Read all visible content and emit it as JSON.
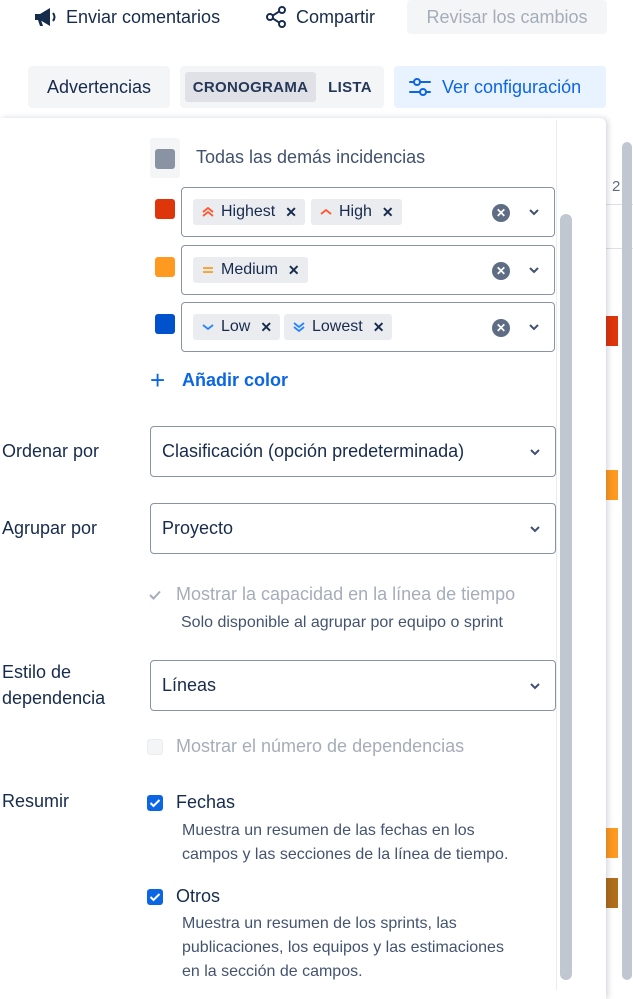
{
  "toolbar": {
    "feedback_label": "Enviar comentarios",
    "share_label": "Compartir",
    "review_label": "Revisar los cambios"
  },
  "view_bar": {
    "warnings_label": "Advertencias",
    "view_modes": [
      "CRONOGRAMA",
      "LISTA"
    ],
    "active_view": "CRONOGRAMA",
    "config_label": "Ver configuración"
  },
  "colors": {
    "accent": "#0c66e4",
    "highest": "#de350b",
    "medium": "#ff991f",
    "low": "#0052cc",
    "all_other": "#8993a4"
  },
  "color_rules": {
    "all_other_label": "Todas las demás incidencias",
    "groups": [
      {
        "color": "#de350b",
        "tags": [
          {
            "label": "Highest",
            "icon": "priority-highest-icon"
          },
          {
            "label": "High",
            "icon": "priority-high-icon"
          }
        ]
      },
      {
        "color": "#ff991f",
        "tags": [
          {
            "label": "Medium",
            "icon": "priority-medium-icon"
          }
        ]
      },
      {
        "color": "#0052cc",
        "tags": [
          {
            "label": "Low",
            "icon": "priority-low-icon"
          },
          {
            "label": "Lowest",
            "icon": "priority-lowest-icon"
          }
        ]
      }
    ],
    "add_color_label": "Añadir color"
  },
  "sort_by": {
    "label": "Ordenar por",
    "value": "Clasificación (opción predeterminada)"
  },
  "group_by": {
    "label": "Agrupar por",
    "value": "Proyecto"
  },
  "capacity": {
    "label": "Mostrar la capacidad en la línea de tiempo",
    "hint": "Solo disponible al agrupar por equipo o sprint",
    "checked": true,
    "disabled": true
  },
  "dependency_style": {
    "label_line1": "Estilo de",
    "label_line2": "dependencia",
    "value": "Líneas"
  },
  "dependency_count": {
    "label": "Mostrar el número de dependencias",
    "checked": false,
    "disabled": true
  },
  "summarize": {
    "label": "Resumir",
    "options": [
      {
        "label": "Fechas",
        "checked": true,
        "desc_lines": [
          "Muestra un resumen de las fechas en los",
          "campos y las secciones de la línea de tiempo."
        ]
      },
      {
        "label": "Otros",
        "checked": true,
        "desc_lines": [
          "Muestra un resumen de los sprints, las",
          "publicaciones, los equipos y las estimaciones",
          "en la sección de campos."
        ]
      }
    ]
  },
  "background": {
    "timeline_header_fragment": "2"
  }
}
